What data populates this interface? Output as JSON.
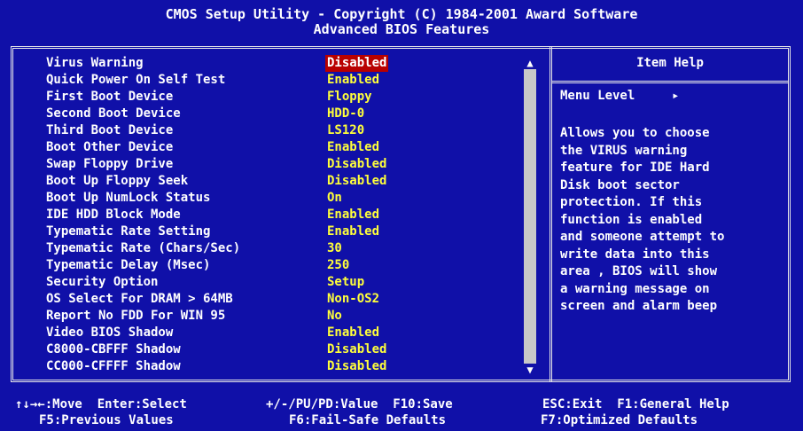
{
  "header": {
    "line1": "CMOS Setup Utility - Copyright (C) 1984-2001 Award Software",
    "line2": "Advanced BIOS Features"
  },
  "settings": [
    {
      "label": "Virus Warning",
      "value": "Disabled",
      "selected": true
    },
    {
      "label": "Quick Power On Self Test",
      "value": "Enabled"
    },
    {
      "label": "First Boot Device",
      "value": "Floppy"
    },
    {
      "label": "Second Boot Device",
      "value": "HDD-0"
    },
    {
      "label": "Third Boot Device",
      "value": "LS120"
    },
    {
      "label": "Boot Other Device",
      "value": "Enabled"
    },
    {
      "label": "Swap Floppy Drive",
      "value": "Disabled"
    },
    {
      "label": "Boot Up Floppy Seek",
      "value": "Disabled"
    },
    {
      "label": "Boot Up NumLock Status",
      "value": "On"
    },
    {
      "label": "IDE HDD Block Mode",
      "value": "Enabled"
    },
    {
      "label": "Typematic Rate Setting",
      "value": "Enabled"
    },
    {
      "label": "Typematic Rate (Chars/Sec)",
      "value": "30"
    },
    {
      "label": "Typematic Delay (Msec)",
      "value": "250"
    },
    {
      "label": "Security Option",
      "value": "Setup"
    },
    {
      "label": "OS Select For DRAM > 64MB",
      "value": "Non-OS2"
    },
    {
      "label": "Report No FDD For WIN 95",
      "value": "No"
    },
    {
      "label": "Video BIOS Shadow",
      "value": "Enabled"
    },
    {
      "label": "C8000-CBFFF Shadow",
      "value": "Disabled"
    },
    {
      "label": "CC000-CFFFF Shadow",
      "value": "Disabled"
    }
  ],
  "scrollbar": {
    "up_glyph": "▲",
    "down_glyph": "▼"
  },
  "help": {
    "title": "Item Help",
    "menu_level": "Menu Level",
    "menu_arrow": "▸",
    "lines": [
      "Allows you to choose",
      "the VIRUS warning",
      "feature for IDE Hard",
      "Disk boot sector",
      "protection. If this",
      "function is enabled",
      "and someone attempt to",
      "write data into this",
      "area , BIOS will show",
      "a warning message on",
      "screen and alarm beep"
    ]
  },
  "footer": {
    "move": "↑↓→←:Move  Enter:Select",
    "value": "+/-/PU/PD:Value  F10:Save",
    "exit": "ESC:Exit  F1:General Help",
    "prev": "F5:Previous Values",
    "failsafe": "F6:Fail-Safe Defaults",
    "optimized": "F7:Optimized Defaults"
  },
  "colors": {
    "background": "#1010a8",
    "value_text": "#ffff3a",
    "highlight": "#b80000",
    "text": "#ffffff"
  }
}
